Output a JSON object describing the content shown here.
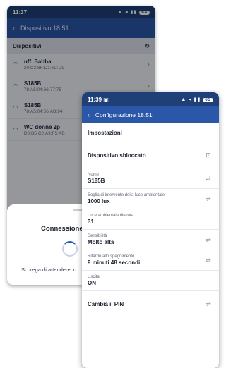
{
  "back_phone": {
    "status": {
      "time": "11:37",
      "battery": "64"
    },
    "appbar": {
      "back_icon": "‹",
      "title": "Dispositivo 18.51"
    },
    "list_header": "Dispositivi",
    "devices": [
      {
        "name": "uff. Sabba",
        "mac": "20:C3:8F:D1:6C:D9"
      },
      {
        "name": "S185B",
        "mac": "78:A5:04:66:77:75"
      },
      {
        "name": "S185B",
        "mac": "78:A5:04:66:AB:94"
      },
      {
        "name": "WC donne 2p",
        "mac": "D0:B5:C2:A9:F5:AB"
      }
    ],
    "sheet": {
      "title": "Connessione",
      "wait_text": "Si prega di attendere, c"
    }
  },
  "front_phone": {
    "status": {
      "time": "11:39",
      "battery": "63"
    },
    "appbar": {
      "back_icon": "‹",
      "title": "Configurazione 18.51"
    },
    "section_title": "Impostazioni",
    "unlock_row": "Dispositivo sbloccato",
    "settings": [
      {
        "label": "Nome",
        "value": "S185B",
        "editable": true
      },
      {
        "label": "Soglia di intervento della luce ambientale",
        "value": "1000 lux",
        "editable": true
      },
      {
        "label": "Luce ambientale rilevata",
        "value": "31",
        "editable": false
      },
      {
        "label": "Sensibilità",
        "value": "Molto alta",
        "editable": true
      },
      {
        "label": "Ritardo allo spegnimento",
        "value": "9 minuti 48 secondi",
        "editable": true
      },
      {
        "label": "Uscita",
        "value": "ON",
        "editable": false
      }
    ],
    "pin_row": "Cambia il PIN"
  },
  "icons": {
    "chevron": "›",
    "wifi": "◠",
    "edit": "⇌",
    "unlock": "🔓"
  },
  "colors": {
    "primary": "#2a57a8",
    "statusbar": "#1f3f78"
  }
}
